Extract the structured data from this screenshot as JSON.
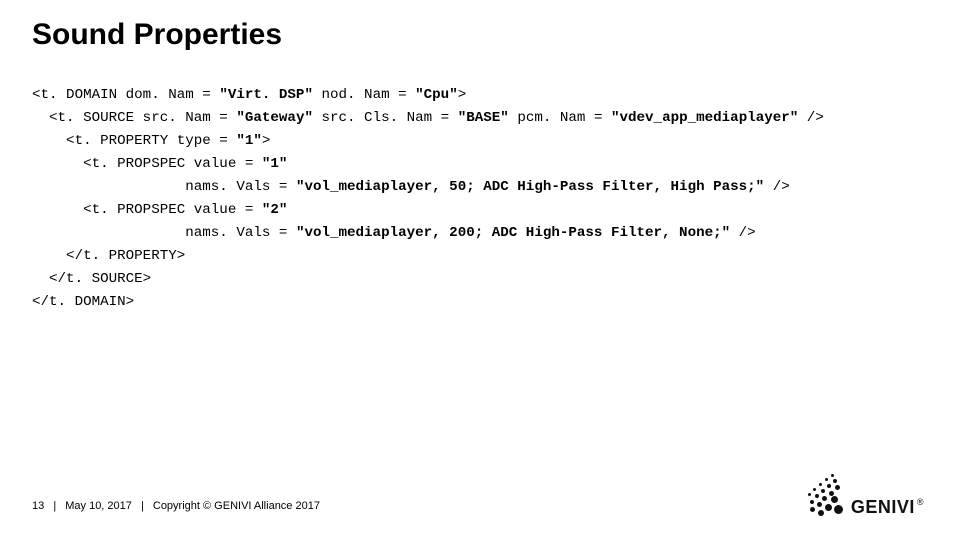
{
  "title": "Sound Properties",
  "code": {
    "l1a": "<t. DOMAIN dom. Nam = ",
    "l1b": "\"Virt. DSP\"",
    "l1c": " nod. Nam = ",
    "l1d": "\"Cpu\"",
    "l1e": ">",
    "l2a": "  <t. SOURCE src. Nam = ",
    "l2b": "\"Gateway\"",
    "l2c": " src. Cls. Nam = ",
    "l2d": "\"BASE\"",
    "l2e": " pcm. Nam = ",
    "l2f": "\"vdev_app_mediaplayer\"",
    "l2g": " />",
    "l3a": "    <t. PROPERTY type = ",
    "l3b": "\"1\"",
    "l3c": ">",
    "l4a": "      <t. PROPSPEC value = ",
    "l4b": "\"1\"",
    "l5a": "                  nams. Vals = ",
    "l5b": "\"vol_mediaplayer, 50; ADC High-Pass Filter, High Pass;\"",
    "l5c": " />",
    "l6a": "      <t. PROPSPEC value = ",
    "l6b": "\"2\"",
    "l7a": "                  nams. Vals = ",
    "l7b": "\"vol_mediaplayer, 200; ADC High-Pass Filter, None;\"",
    "l7c": " />",
    "l8": "    </t. PROPERTY>",
    "l9": "  </t. SOURCE>",
    "l10": "</t. DOMAIN>"
  },
  "footer": {
    "page": "13",
    "date": "May 10, 2017",
    "copyright": "Copyright © GENIVI Alliance 2017"
  },
  "logo": {
    "text": "GENIVI",
    "reg": "®"
  }
}
